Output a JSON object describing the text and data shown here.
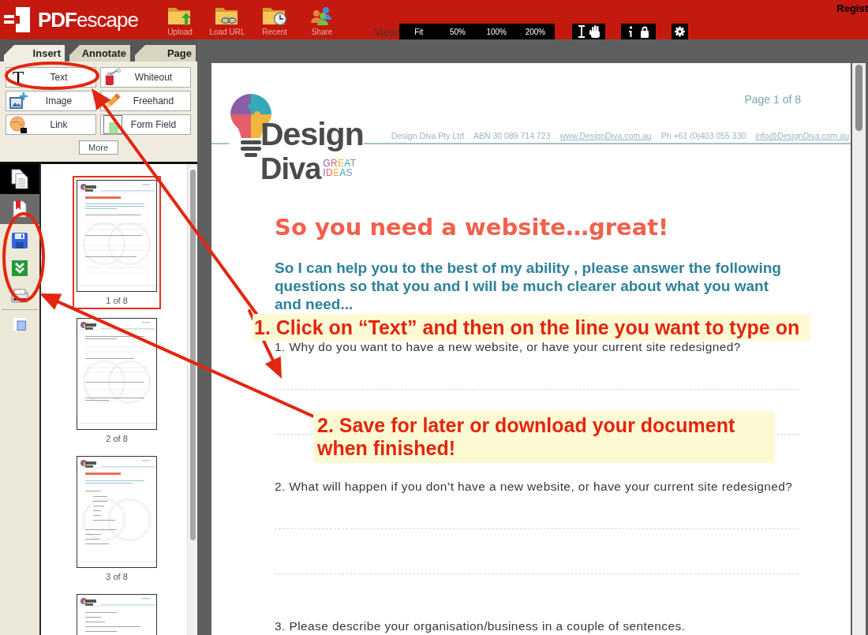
{
  "toolbar": {
    "logo": "**PDF**escape",
    "actions": [
      {
        "label": "Upload"
      },
      {
        "label": "Load URL"
      },
      {
        "label": "Recent"
      },
      {
        "label": "Share"
      }
    ],
    "view_label": "View",
    "zoom_options": [
      {
        "label": "Fit"
      },
      {
        "label": "50%"
      },
      {
        "label": "100%"
      },
      {
        "label": "200%"
      }
    ],
    "account_link": "Regist"
  },
  "tool_panel": {
    "tabs": [
      {
        "label": "Insert",
        "selected": true
      },
      {
        "label": "Annotate",
        "selected": false
      },
      {
        "label": "Page",
        "selected": false
      }
    ],
    "tools": [
      {
        "glyph": "T",
        "label": "Text"
      },
      {
        "label": "Whiteout"
      },
      {
        "label": "Image"
      },
      {
        "label": "Freehand"
      },
      {
        "label": "Link"
      },
      {
        "label": "Form Field"
      }
    ],
    "more_button": "More"
  },
  "side_panel": {
    "tabs": [
      {
        "selected": true
      },
      {
        "selected": false
      }
    ],
    "thumbnails": [
      {
        "label": "1 of 8",
        "selected": true
      },
      {
        "label": "2 of 8",
        "selected": false
      },
      {
        "label": "3 of 8",
        "selected": false
      },
      {
        "selected": false
      }
    ]
  },
  "document": {
    "page_number": "Page 1 of 8",
    "logo": {
      "line_1": "Design",
      "line_2": "Diva",
      "tagline_1": "GREAT",
      "tagline_2": "IDEAS"
    },
    "contact": [
      {
        "kind": "text",
        "text": "Design Diva Pty Ltd"
      },
      {
        "kind": "text",
        "text": "ABN 30 089 714 723"
      },
      {
        "kind": "link",
        "text": "www.DesignDiva.com.au"
      },
      {
        "kind": "text",
        "text": "Ph +61 (0)403 055 330"
      },
      {
        "kind": "link",
        "text": "info@DesignDiva.com.au"
      }
    ],
    "title": "So you need a website…great!",
    "intro": "So I can help you to the best of my ability , please answer the following questions so that you and I will be much clearer about what you want and need...",
    "questions": [
      {
        "text": "1. Why do you want to have a new website, or have your current site redesigned?",
        "answer_lines": true
      },
      {
        "text": "2. What will happen if you don’t have a new website, or have your current site redesigned?",
        "answer_lines": true
      },
      {
        "text": "3. Please describe your organisation/business in a couple of sentences."
      }
    ]
  },
  "annotations": {
    "callouts": [
      {
        "text": "1. Click on “Text” and then on the line you want to type on"
      },
      {
        "text": "2. Save for later or download your document when finished!"
      }
    ]
  }
}
